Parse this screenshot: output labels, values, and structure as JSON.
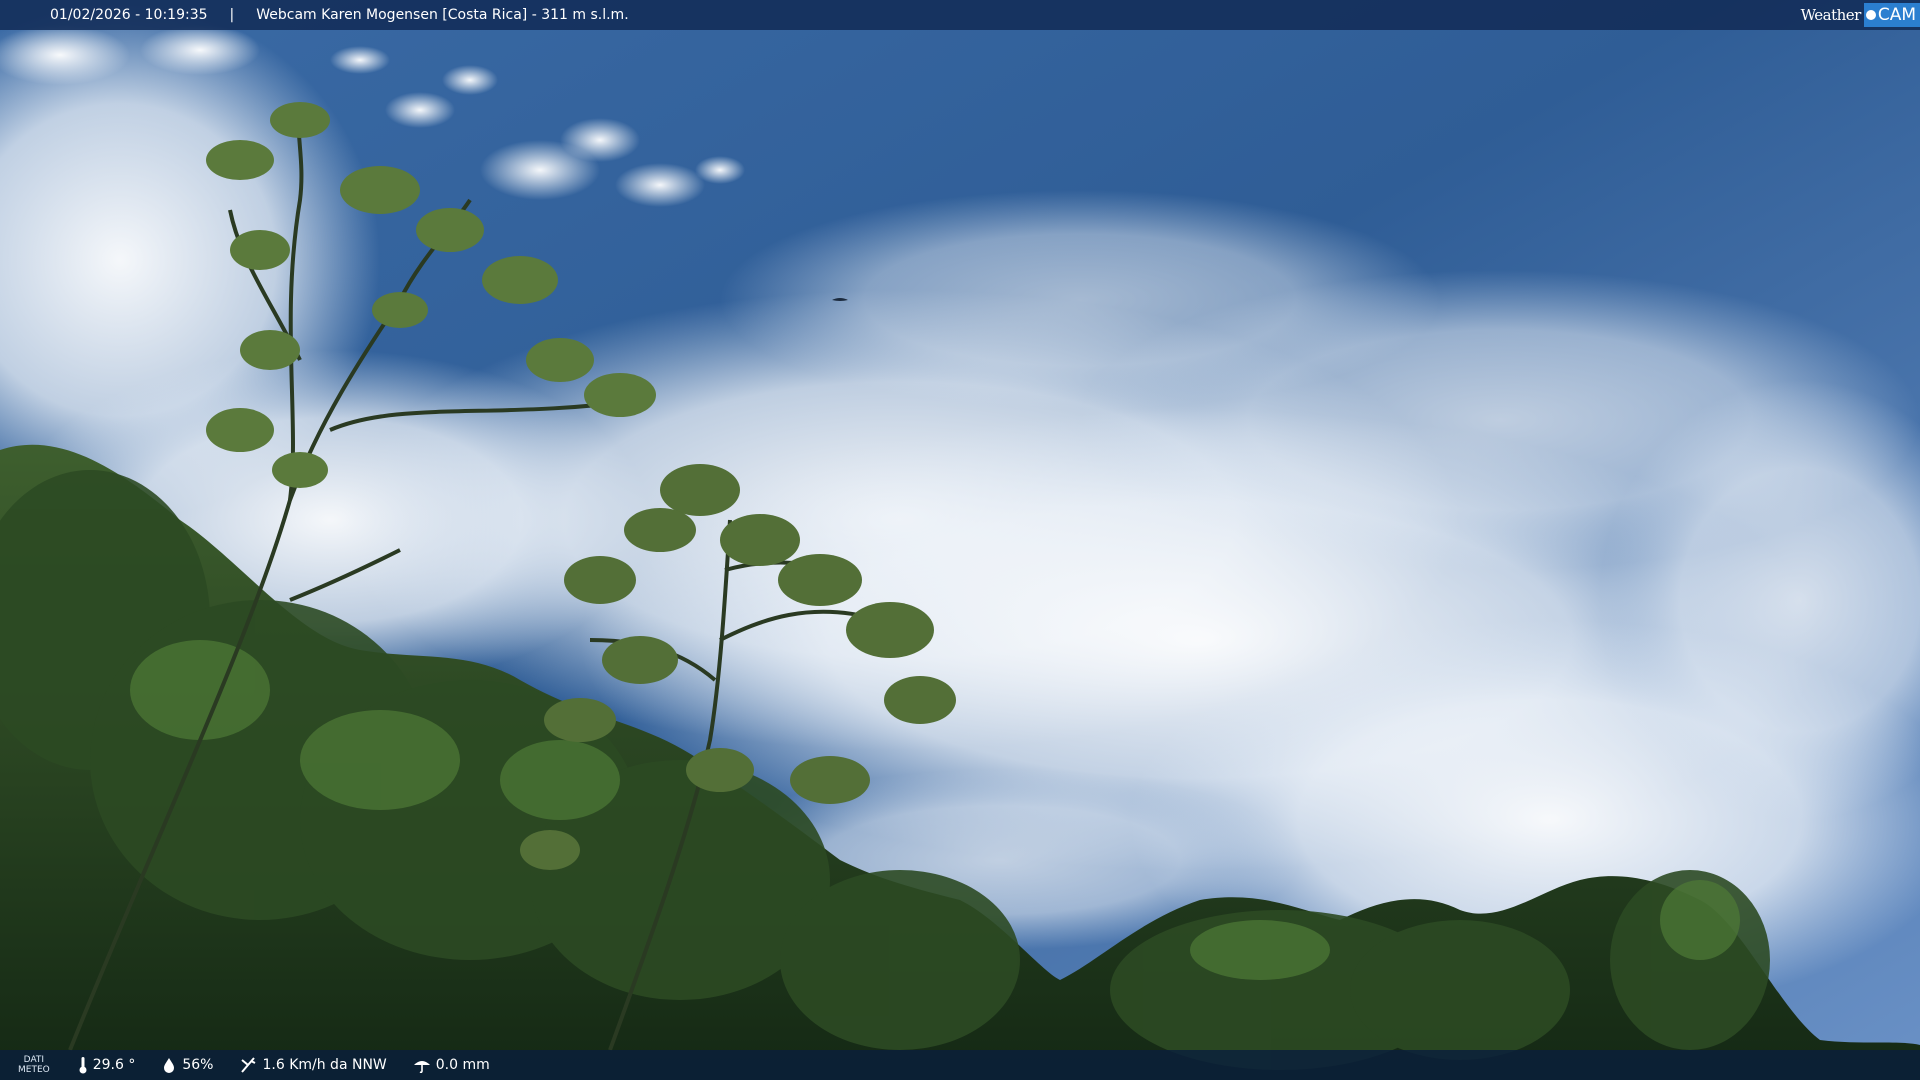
{
  "header": {
    "datetime": "01/02/2026 - 10:19:35",
    "separator": "|",
    "title": "Webcam Karen Mogensen [Costa Rica] - 311 m s.l.m."
  },
  "brand": {
    "weather": "Weather",
    "cam": "CAM",
    "accent": "#2b7fd0"
  },
  "footer": {
    "label_line1": "DATI",
    "label_line2": "METEO",
    "temperature": "29.6 °",
    "humidity": "56%",
    "wind": "1.6 Km/h da NNW",
    "rain": "0.0 mm",
    "icons": [
      "thermometer-icon",
      "humidity-icon",
      "wind-icon",
      "rain-icon"
    ]
  },
  "colors": {
    "sky_top": "#2a5a94",
    "sky_mid": "#5d87bf",
    "cloud": "#f3f6fa",
    "foliage_dark": "#1a3017",
    "foliage_mid": "#34562a"
  }
}
